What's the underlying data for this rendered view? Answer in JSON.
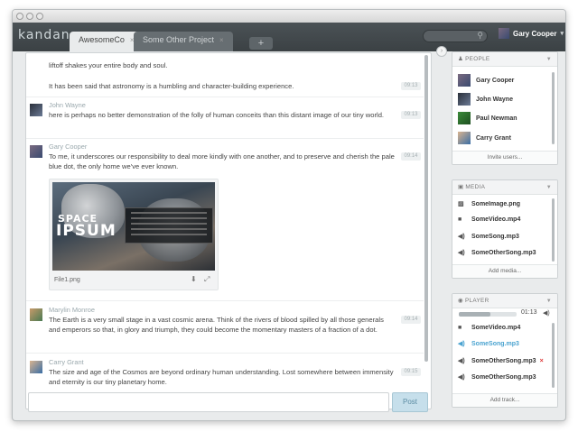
{
  "logo": "kandan",
  "tabs": [
    {
      "label": "AwesomeCo",
      "close": "×"
    },
    {
      "label": "Some Other Project",
      "close": "×"
    }
  ],
  "newtab_label": "+",
  "user": {
    "name": "Gary Cooper",
    "caret": "▾"
  },
  "messages": [
    {
      "name": "",
      "text": "liftoff shakes your entire body and soul.",
      "time": ""
    },
    {
      "name": "",
      "text": "It has been said that astronomy is a humbling and character-building experience.",
      "time": "09:13"
    },
    {
      "name": "John Wayne",
      "text": "here is perhaps no better demonstration of the folly of human conceits than this distant image of our tiny world.",
      "time": "09:13"
    },
    {
      "name": "Gary Cooper",
      "text": "To me, it underscores our responsibility to deal more kindly with one another, and to preserve and cherish the pale blue dot, the only home we've ever known.",
      "time": "09:14"
    },
    {
      "name": "Marylin Monroe",
      "text": "The Earth is a very small stage in a vast cosmic arena. Think of the rivers of blood spilled by all those generals and emperors so that, in glory and triumph, they could become the momentary masters of a fraction of a dot.",
      "time": "09:14"
    },
    {
      "name": "Carry Grant",
      "text": "The size and age of the Cosmos are beyond ordinary human understanding. Lost somewhere between immensity and eternity is our tiny planetary home.",
      "time": "09:15"
    }
  ],
  "attachment": {
    "filename": "File1.png",
    "title_line1": "SPACE",
    "title_line2": "IPSUM"
  },
  "composer": {
    "placeholder": "",
    "post_label": "Post"
  },
  "people": {
    "header": "PEOPLE",
    "items": [
      "Gary Cooper",
      "John Wayne",
      "Paul Newman",
      "Carry Grant"
    ],
    "footer": "Invite users..."
  },
  "media": {
    "header": "MEDIA",
    "items": [
      {
        "label": "SomeImage.png",
        "icon": "image-icon"
      },
      {
        "label": "SomeVideo.mp4",
        "icon": "video-icon"
      },
      {
        "label": "SomeSong.mp3",
        "icon": "audio-icon"
      },
      {
        "label": "SomeOtherSong.mp3",
        "icon": "audio-icon"
      }
    ],
    "footer": "Add media..."
  },
  "player": {
    "header": "PLAYER",
    "time": "01:13",
    "progress": 0.55,
    "tracks": [
      {
        "label": "SomeVideo.mp4",
        "icon": "video-icon"
      },
      {
        "label": "SomeSong.mp3",
        "icon": "audio-icon",
        "active": true
      },
      {
        "label": "SomeOtherSong.mp3",
        "icon": "audio-icon",
        "remove": "×"
      },
      {
        "label": "SomeOtherSong.mp3",
        "icon": "audio-icon"
      }
    ],
    "footer": "Add track..."
  },
  "colors": {
    "accent": "#4aa3d0",
    "appbar": "#3f4548",
    "remove": "#dd3333"
  }
}
